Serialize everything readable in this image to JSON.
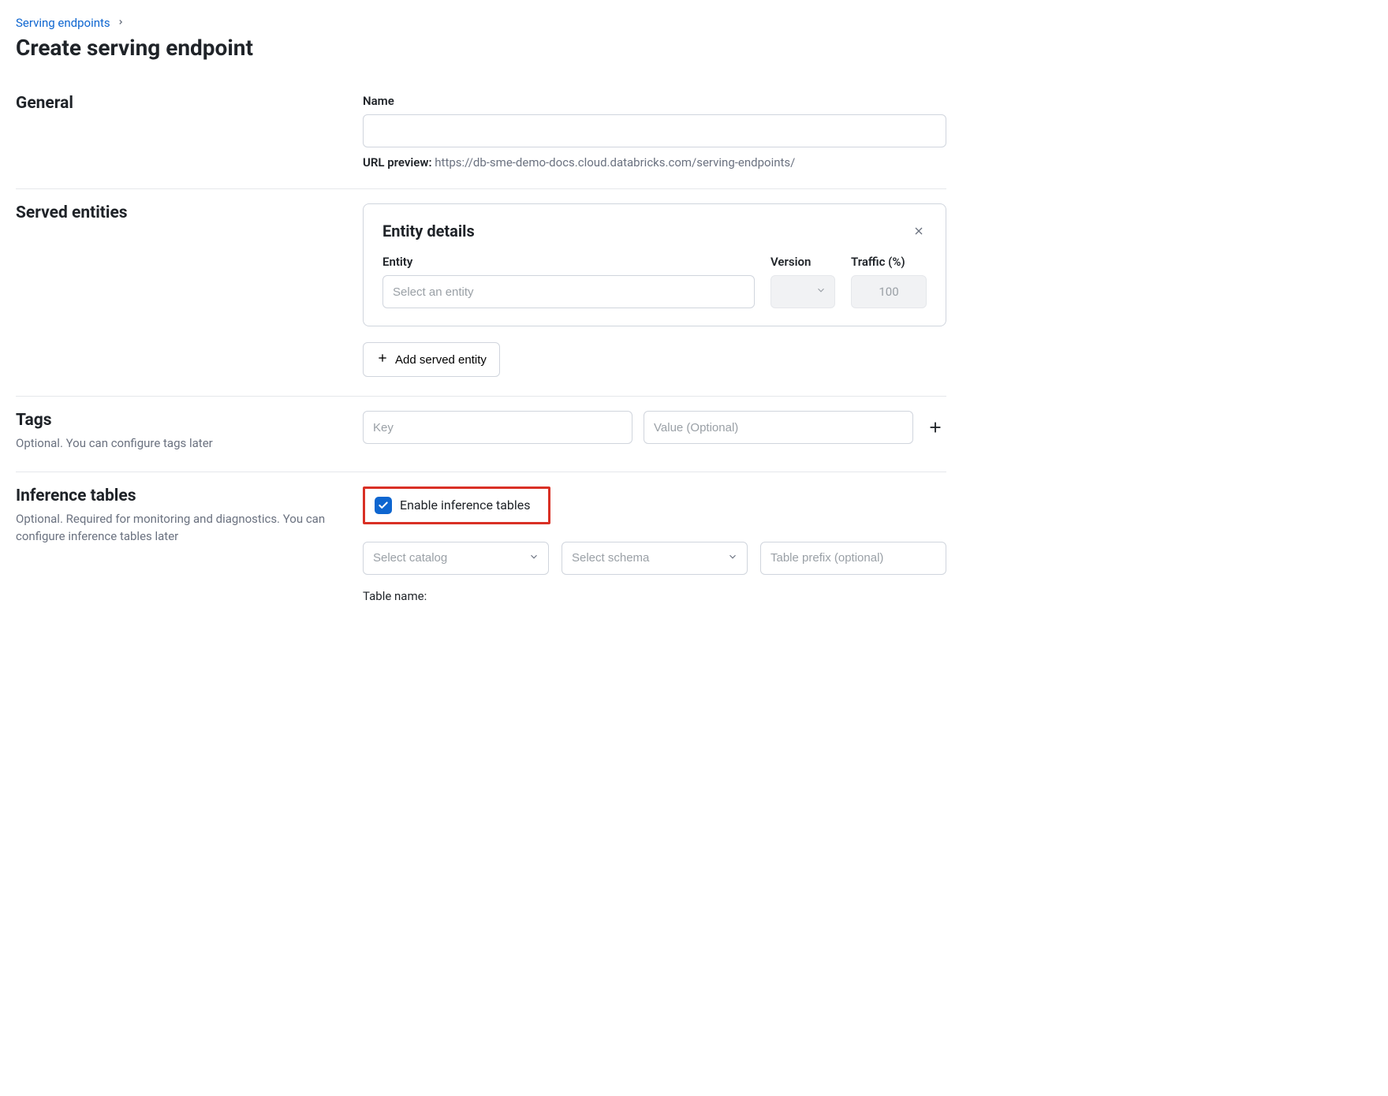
{
  "breadcrumb": {
    "link": "Serving endpoints"
  },
  "page_title": "Create serving endpoint",
  "general": {
    "section_title": "General",
    "name_label": "Name",
    "name_value": "",
    "url_preview_label": "URL preview:",
    "url_preview_value": "https://db-sme-demo-docs.cloud.databricks.com/serving-endpoints/"
  },
  "served": {
    "section_title": "Served entities",
    "card_title": "Entity details",
    "entity_label": "Entity",
    "version_label": "Version",
    "traffic_label": "Traffic (%)",
    "entity_placeholder": "Select an entity",
    "version_value": "",
    "traffic_value": "100",
    "add_button": "Add served entity"
  },
  "tags": {
    "section_title": "Tags",
    "subtitle": "Optional. You can configure tags later",
    "key_placeholder": "Key",
    "value_placeholder": "Value (Optional)"
  },
  "inference": {
    "section_title": "Inference tables",
    "subtitle": "Optional. Required for monitoring and diagnostics. You can configure inference tables later",
    "checkbox_label": "Enable inference tables",
    "checkbox_checked": true,
    "catalog_placeholder": "Select catalog",
    "schema_placeholder": "Select schema",
    "prefix_placeholder": "Table prefix (optional)",
    "table_name_label": "Table name:"
  }
}
